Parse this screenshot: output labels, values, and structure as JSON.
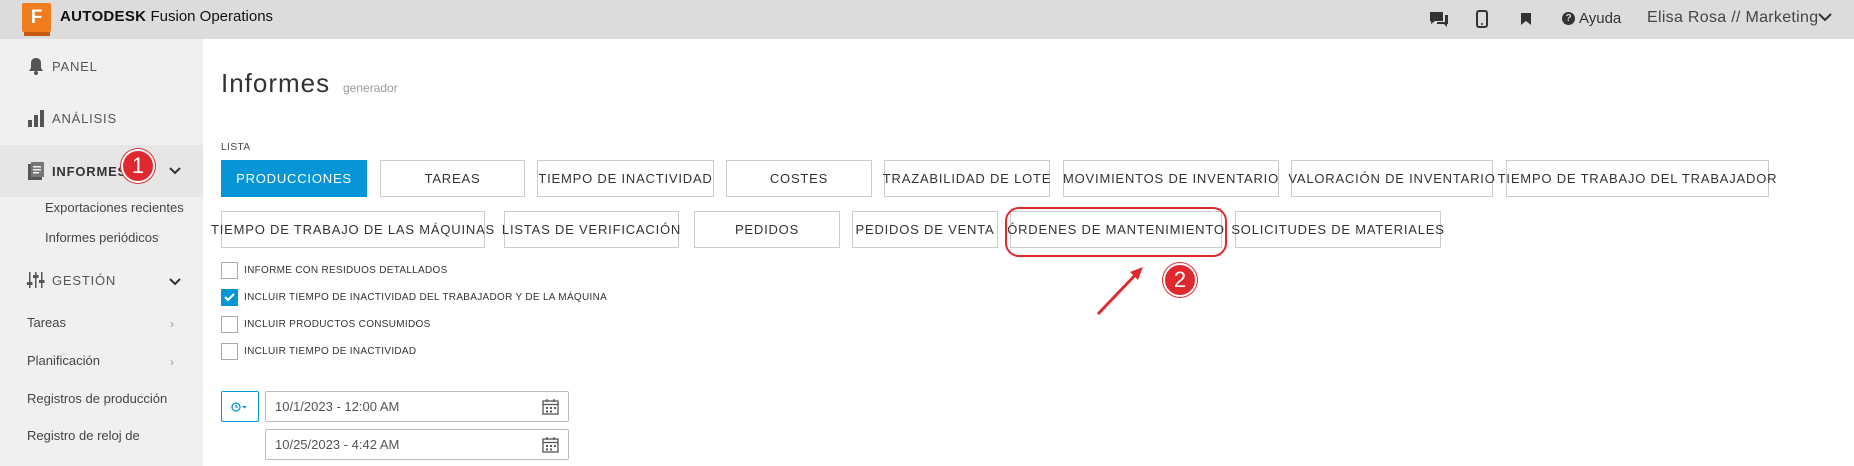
{
  "app": {
    "logo_letter": "F",
    "brand_bold": "AUTODESK",
    "brand_rest": " Fusion Operations",
    "brand_color": "#f07c1d"
  },
  "topbar": {
    "help_label": "Ayuda",
    "user_label": "Elisa Rosa // Marketing",
    "icons": [
      "chat-icon",
      "mobile-icon",
      "bookmark-icon",
      "help-icon",
      "chevron-down-icon"
    ]
  },
  "sidebar": {
    "panel": "PANEL",
    "analisis": "ANÁLISIS",
    "informes": "INFORMES",
    "informes_badge": "1",
    "sub": [
      "Exportaciones recientes",
      "Informes periódicos"
    ],
    "gestion": "GESTIÓN",
    "items": [
      "Tareas",
      "Planificación",
      "Registros de producción",
      "Registro de reloj de"
    ]
  },
  "main": {
    "title": "Informes",
    "subtitle": "generador",
    "lista_label": "LISTA",
    "row1": [
      "PRODUCCIONES",
      "TAREAS",
      "TIEMPO DE INACTIVIDAD",
      "COSTES",
      "TRAZABILIDAD DE LOTE",
      "MOVIMIENTOS DE INVENTARIO",
      "VALORACIÓN DE INVENTARIO",
      "TIEMPO DE TRABAJO DEL TRABAJADOR"
    ],
    "row2": [
      "TIEMPO DE TRABAJO DE LAS MÁQUINAS",
      "LISTAS DE VERIFICACIÓN",
      "PEDIDOS",
      "PEDIDOS DE VENTA",
      "ÓRDENES DE MANTENIMIENTO",
      "SOLICITUDES DE MATERIALES"
    ],
    "active_button": "PRODUCCIONES",
    "options": [
      {
        "label": "INFORME CON RESIDUOS DETALLADOS",
        "checked": false
      },
      {
        "label": "INCLUIR TIEMPO DE INACTIVIDAD DEL TRABAJADOR Y DE LA MÁQUINA",
        "checked": true
      },
      {
        "label": "INCLUIR PRODUCTOS CONSUMIDOS",
        "checked": false
      },
      {
        "label": "INCLUIR TIEMPO DE INACTIVIDAD",
        "checked": false
      }
    ],
    "date_from": "10/1/2023 - 12:00 AM",
    "date_to": "10/25/2023 - 4:42 AM",
    "annotation_badge": "2",
    "accent_color": "#0696d7",
    "annotation_color": "#e0292f"
  }
}
